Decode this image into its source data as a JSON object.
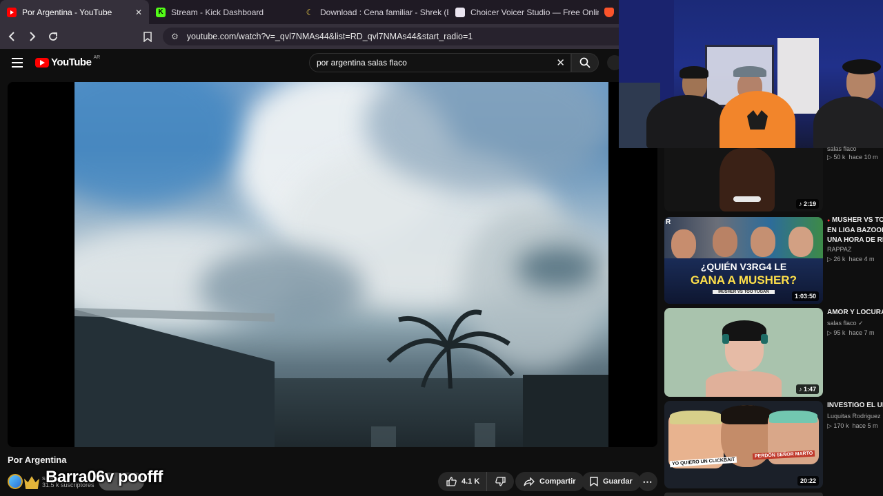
{
  "browser": {
    "tabs": [
      {
        "title": "Por Argentina - YouTube",
        "active": true
      },
      {
        "title": "Stream - Kick Dashboard",
        "active": false
      },
      {
        "title": "Download : Cena familiar - Shrek (Esp",
        "active": false
      },
      {
        "title": "Choicer Voicer Studio — Free Online",
        "active": false
      }
    ],
    "close_glyph": "✕",
    "url": "youtube.com/watch?v=_qvl7NMAs44&list=RD_qvl7NMAs44&start_radio=1"
  },
  "youtube": {
    "logo_text": "YouTube",
    "country": "AR",
    "search_query": "por argentina salas flaco"
  },
  "video": {
    "title": "Por Argentina",
    "channel_subs": "31.5 k suscriptores",
    "channel_short": "sala",
    "overlay_text": "Barra06v poofff",
    "subscribe_label": "ibirs",
    "likes": "4.1 K",
    "share_label": "Compartir",
    "save_label": "Guardar"
  },
  "sidebar": {
    "items": [
      {
        "title": "",
        "channel": "salas flaco",
        "views": "50 k",
        "ago": "hace 10 m",
        "duration": "2:19",
        "music": true
      },
      {
        "title_lines": [
          "MUSHER VS TO",
          "EN LIGA BAZOOKA",
          "UNA HORA DE RIS"
        ],
        "channel": "RAPPAZ",
        "views": "26 k",
        "ago": "hace 4 m",
        "duration": "1:03:50",
        "live_dot": true,
        "thumb_text": "¿QUIÉN V3RG4 LE",
        "thumb_text2": "GANA A MUSHER?",
        "thumb_caption": "MUSHER VS TOO YUGAN"
      },
      {
        "title_lines": [
          "AMOR Y LOCURA"
        ],
        "channel": "salas flaco",
        "views": "95 k",
        "ago": "hace 7 m",
        "duration": "1:47",
        "music": true
      },
      {
        "title_lines": [
          "INVESTIGO EL UNI"
        ],
        "channel": "Luquitas Rodriguez",
        "views": "170 k",
        "ago": "hace 5 m",
        "duration": "20:22",
        "thumb_text": "YO QUIERO UN CLICKBAIT",
        "thumb_text2": "PERDÓN SEÑOR MARTO"
      }
    ]
  },
  "colors": {
    "yt_red": "#ff0000",
    "bg": "#0f0f0f",
    "chrome_tab": "#1f1a24",
    "chrome_bar": "#35303b"
  }
}
